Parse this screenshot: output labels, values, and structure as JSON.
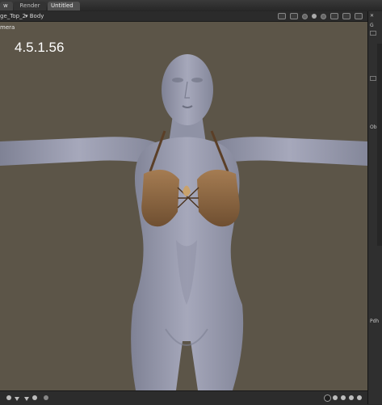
{
  "tabs": [
    {
      "label": "w"
    },
    {
      "label": "Render"
    },
    {
      "label": "Untitled"
    }
  ],
  "breadcrumb": {
    "node": "ge_Top_2",
    "target": "Body"
  },
  "viewport": {
    "camera_label": "mera",
    "version_text": "4.5.1.56"
  },
  "right_panel": {
    "items": [
      "G",
      "Ob",
      "Pdh"
    ]
  },
  "colors": {
    "viewport_bg": "#5c5548",
    "skin": "#9a9cae",
    "top_leather": "#8f6a46"
  }
}
